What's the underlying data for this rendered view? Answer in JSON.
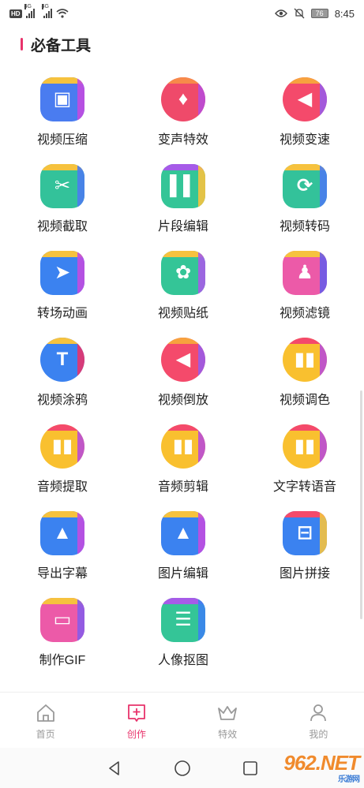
{
  "status_bar": {
    "left_badge": "HD",
    "sig1": "4G",
    "sig2": "4G",
    "battery": "76",
    "time": "8:45"
  },
  "section": {
    "title": "必备工具"
  },
  "tools": [
    {
      "label": "视频压缩",
      "icon": "compress-icon",
      "shape": "square",
      "bg": "#4a7cf0",
      "a": "#f6c23e",
      "b": "#c24be0"
    },
    {
      "label": "变声特效",
      "icon": "voice-changer-icon",
      "shape": "circle",
      "bg": "#ef4a6a",
      "a": "#f78a4a",
      "b": "#b94bd8"
    },
    {
      "label": "视频变速",
      "icon": "speed-icon",
      "shape": "circle",
      "bg": "#f44a6b",
      "a": "#f7a23e",
      "b": "#9a5be8"
    },
    {
      "label": "视频截取",
      "icon": "cut-icon",
      "shape": "square",
      "bg": "#33c29a",
      "a": "#f6c23e",
      "b": "#4a7cf0"
    },
    {
      "label": "片段编辑",
      "icon": "clip-edit-icon",
      "shape": "square",
      "bg": "#34c597",
      "a": "#a65be8",
      "b": "#f6c23e"
    },
    {
      "label": "视频转码",
      "icon": "transcode-icon",
      "shape": "square",
      "bg": "#33c29a",
      "a": "#f6c23e",
      "b": "#4a7cf0"
    },
    {
      "label": "转场动画",
      "icon": "transition-icon",
      "shape": "square",
      "bg": "#3b82f0",
      "a": "#f6c23e",
      "b": "#c24be0"
    },
    {
      "label": "视频贴纸",
      "icon": "sticker-icon",
      "shape": "square",
      "bg": "#34c597",
      "a": "#f6c23e",
      "b": "#a65be8"
    },
    {
      "label": "视频滤镜",
      "icon": "filter-icon",
      "shape": "square",
      "bg": "#ec5aa8",
      "a": "#f6c23e",
      "b": "#6a5be8"
    },
    {
      "label": "视频涂鸦",
      "icon": "doodle-icon",
      "shape": "circle",
      "bg": "#3b82f0",
      "a": "#f6c23e",
      "b": "#e8336b"
    },
    {
      "label": "视频倒放",
      "icon": "reverse-icon",
      "shape": "circle",
      "bg": "#f44a6b",
      "a": "#f7a23e",
      "b": "#9a5be8"
    },
    {
      "label": "视频调色",
      "icon": "color-grade-icon",
      "shape": "circle",
      "bg": "#f9c02f",
      "a": "#f44a6b",
      "b": "#b94bd8"
    },
    {
      "label": "音频提取",
      "icon": "audio-extract-icon",
      "shape": "circle",
      "bg": "#f9c02f",
      "a": "#f44a6b",
      "b": "#b94bd8"
    },
    {
      "label": "音频剪辑",
      "icon": "audio-cut-icon",
      "shape": "circle",
      "bg": "#f9c02f",
      "a": "#f44a6b",
      "b": "#b94bd8"
    },
    {
      "label": "文字转语音",
      "icon": "text-to-speech-icon",
      "shape": "circle",
      "bg": "#f9c02f",
      "a": "#f44a6b",
      "b": "#b94bd8"
    },
    {
      "label": "导出字幕",
      "icon": "subtitle-export-icon",
      "shape": "square",
      "bg": "#3b82f0",
      "a": "#f6c23e",
      "b": "#c24be0"
    },
    {
      "label": "图片编辑",
      "icon": "image-edit-icon",
      "shape": "square",
      "bg": "#3b82f0",
      "a": "#f6c23e",
      "b": "#c24be0"
    },
    {
      "label": "图片拼接",
      "icon": "image-join-icon",
      "shape": "square",
      "bg": "#3b82f0",
      "a": "#f44a6b",
      "b": "#f6c23e"
    },
    {
      "label": "制作GIF",
      "icon": "gif-icon",
      "shape": "square",
      "bg": "#ec5aa8",
      "a": "#f6c23e",
      "b": "#8a5be8"
    },
    {
      "label": "人像抠图",
      "icon": "portrait-cutout-icon",
      "shape": "square",
      "bg": "#34c597",
      "a": "#a65be8",
      "b": "#3b82f0"
    }
  ],
  "bottom_nav": [
    {
      "label": "首页",
      "icon": "home-icon",
      "active": false
    },
    {
      "label": "创作",
      "icon": "create-icon",
      "active": true
    },
    {
      "label": "特效",
      "icon": "effects-crown-icon",
      "active": false
    },
    {
      "label": "我的",
      "icon": "profile-icon",
      "active": false
    }
  ],
  "watermark": {
    "text": "962.NET",
    "sub": "乐游网"
  },
  "colors": {
    "accent": "#e8336b",
    "nav_inactive": "#999999"
  }
}
